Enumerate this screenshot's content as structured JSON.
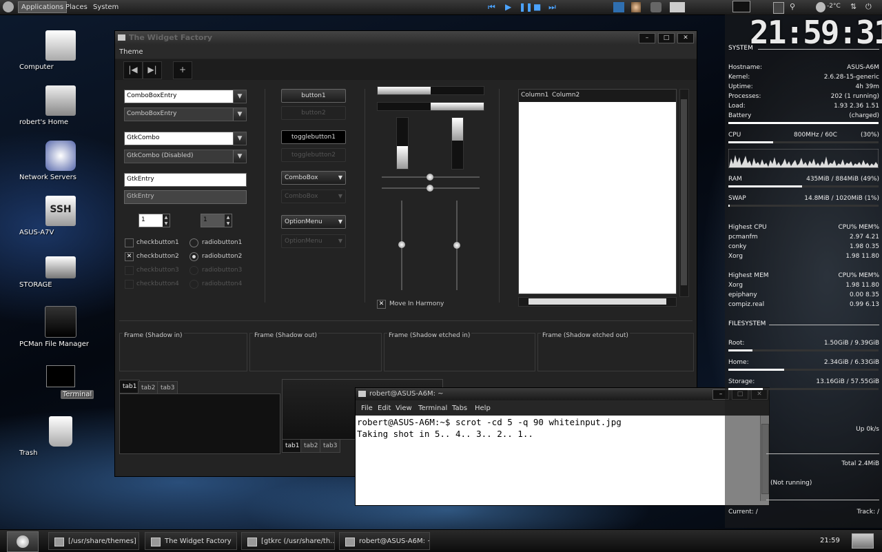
{
  "top_panel": {
    "menus": [
      "Applications",
      "Places",
      "System"
    ],
    "weather": "-2°C"
  },
  "desktop_icons": [
    {
      "label": "Computer",
      "icon": "computer-icon"
    },
    {
      "label": "robert's Home",
      "icon": "home-folder-icon"
    },
    {
      "label": "Network Servers",
      "icon": "network-icon"
    },
    {
      "label": "ASUS-A7V",
      "icon": "ssh-icon"
    },
    {
      "label": "STORAGE",
      "icon": "drive-icon"
    },
    {
      "label": "PCMan File Manager",
      "icon": "file-manager-icon"
    },
    {
      "label": "Terminal",
      "icon": "terminal-icon"
    },
    {
      "label": "Trash",
      "icon": "trash-icon"
    }
  ],
  "widget_factory": {
    "title": "The Widget Factory",
    "menu": "Theme",
    "col1": {
      "combo_entry_1": "ComboBoxEntry",
      "combo_entry_2": "ComboBoxEntry",
      "gtk_combo_1": "GtkCombo",
      "gtk_combo_2": "GtkCombo (Disabled)",
      "entry_1": "GtkEntry",
      "entry_2": "GtkEntry",
      "spin_1": "1",
      "spin_2": "1",
      "checks": [
        "checkbutton1",
        "checkbutton2",
        "checkbutton3",
        "checkbutton4"
      ],
      "radios": [
        "radiobutton1",
        "radiobutton2",
        "radiobutton3",
        "radiobutton4"
      ]
    },
    "col2": {
      "button1": "button1",
      "button2": "button2",
      "toggle1": "togglebutton1",
      "toggle2": "togglebutton2",
      "combobox1": "ComboBox",
      "combobox2": "ComboBox",
      "optionmenu1": "OptionMenu",
      "optionmenu2": "OptionMenu"
    },
    "col3": {
      "progress_h1": 0.5,
      "progress_h2": 0.5,
      "progress_v1": 0.45,
      "progress_v2": 0.45,
      "move_in_harmony": "Move In Harmony"
    },
    "tree": {
      "col1": "Column1",
      "col2": "Column2"
    },
    "frames": [
      "Frame (Shadow in)",
      "Frame (Shadow out)",
      "Frame (Shadow etched in)",
      "Frame (Shadow etched out)"
    ],
    "tabs": [
      "tab1",
      "tab2",
      "tab3"
    ]
  },
  "terminal": {
    "title": "robert@ASUS-A6M: ~",
    "menu": [
      "File",
      "Edit",
      "View",
      "Terminal",
      "Tabs",
      "Help"
    ],
    "lines": [
      "robert@ASUS-A6M:~$ scrot -cd 5 -q 90 whiteinput.jpg",
      "Taking shot in 5.. 4.. 3.. 2.. 1.."
    ]
  },
  "conky": {
    "clock": "21:59:31",
    "system_label": "SYSTEM",
    "rows": [
      {
        "k": "Hostname:",
        "v": "ASUS-A6M"
      },
      {
        "k": "Kernel:",
        "v": "2.6.28-15-generic"
      },
      {
        "k": "Uptime:",
        "v": "4h 39m"
      },
      {
        "k": "Processes:",
        "v": "202 (1 running)"
      },
      {
        "k": "Load:",
        "v": "1.93 2.36 1.51"
      },
      {
        "k": "Battery",
        "v": "(charged)"
      }
    ],
    "cpu": {
      "k": "CPU",
      "mid": "800MHz / 60C",
      "v": "(30%)",
      "fill": 0.3
    },
    "ram": {
      "k": "RAM",
      "v": "435MiB / 884MiB (49%)",
      "fill": 0.49
    },
    "swap": {
      "k": "SWAP",
      "v": "14.8MiB / 1020MiB (1%)",
      "fill": 0.01
    },
    "highest_cpu": {
      "k": "Highest CPU",
      "v": "CPU% MEM%",
      "rows": [
        {
          "k": "pcmanfm",
          "v": "2.97 4.21"
        },
        {
          "k": "conky",
          "v": "1.98 0.35"
        },
        {
          "k": "Xorg",
          "v": "1.98 11.80"
        }
      ]
    },
    "highest_mem": {
      "k": "Highest MEM",
      "v": "CPU% MEM%",
      "rows": [
        {
          "k": "Xorg",
          "v": "1.98 11.80"
        },
        {
          "k": "epiphany",
          "v": "0.00 8.35"
        },
        {
          "k": "compiz.real",
          "v": "0.99 6.13"
        }
      ]
    },
    "filesystem_label": "FILESYSTEM",
    "fs": [
      {
        "k": "Root:",
        "v": "1.50GiB / 9.39GiB",
        "fill": 0.16
      },
      {
        "k": "Home:",
        "v": "2.34GiB / 6.33GiB",
        "fill": 0.37
      },
      {
        "k": "Storage:",
        "v": "13.16GiB / 57.55GiB",
        "fill": 0.23
      }
    ],
    "net_up": "Up 0k/s",
    "net_total": "Total 2.4MiB",
    "notrunning": "(Not running)",
    "current": "Current: /",
    "track": "Track: /"
  },
  "taskbar": {
    "tasks": [
      "[/usr/share/themes]",
      "The Widget Factory",
      "[gtkrc (/usr/share/th...",
      "robert@ASUS-A6M: ~"
    ],
    "clock": "21:59"
  }
}
